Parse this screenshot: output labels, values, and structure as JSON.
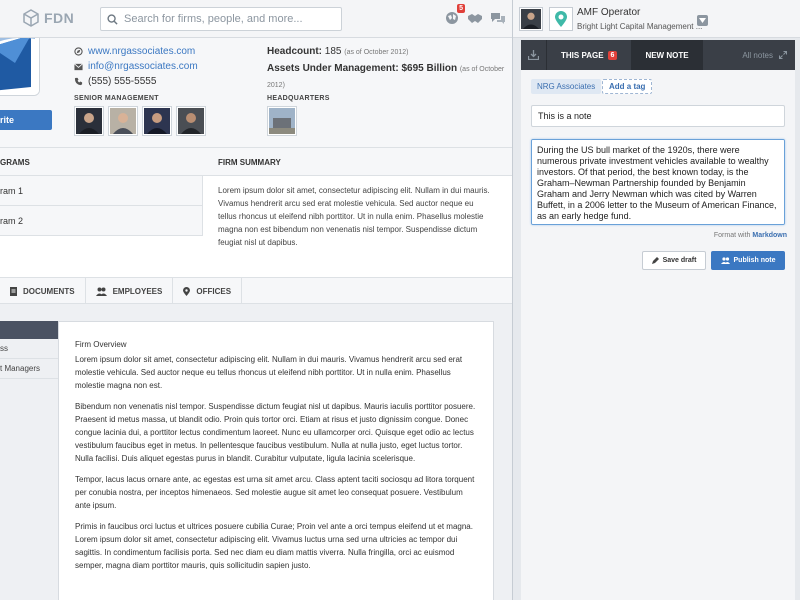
{
  "app": {
    "logo_text": "FDN"
  },
  "search": {
    "placeholder": "Search for firms, people, and more..."
  },
  "notifications": {
    "count": "5"
  },
  "profile": {
    "website": "www.nrgassociates.com",
    "email": "info@nrgassociates.com",
    "phone": "(555) 555-5555",
    "headcount_label": "Headcount:",
    "headcount_value": "185",
    "headcount_note": "(as of October 2012)",
    "aum_label": "Assets Under Management:",
    "aum_value": "$695 Billion",
    "aum_note": "(as of October 2012)",
    "favorite_label": "rite",
    "senior_management_label": "Senior Management",
    "headquarters_label": "Headquarters"
  },
  "programs": {
    "header": "grams",
    "items": [
      "ram 1",
      "ram 2"
    ]
  },
  "firm_summary": {
    "header": "Firm Summary",
    "text": "Lorem ipsum dolor sit amet, consectetur adipiscing elit. Nullam in dui mauris. Vivamus hendrerit arcu sed erat molestie vehicula. Sed auctor neque eu tellus rhoncus ut eleifend nibh porttitor. Ut in nulla enim. Phasellus molestie magna non est bibendum non venenatis nisl tempor. Suspendisse dictum feugiat nisl ut dapibus."
  },
  "tabs": [
    {
      "label": "Documents",
      "icon": "document-icon"
    },
    {
      "label": "Employees",
      "icon": "people-icon"
    },
    {
      "label": "Offices",
      "icon": "map-pin-icon"
    }
  ],
  "side_nav": {
    "items": [
      "ss",
      "t Managers"
    ]
  },
  "overview": {
    "title": "Firm Overview",
    "paragraphs": [
      "Lorem ipsum dolor sit amet, consectetur adipiscing elit. Nullam in dui mauris. Vivamus hendrerit arcu sed erat molestie vehicula. Sed auctor neque eu tellus rhoncus ut eleifend nibh porttitor. Ut in nulla enim. Phasellus molestie magna non est.",
      "Bibendum non venenatis nisl tempor. Suspendisse dictum feugiat nisl ut dapibus. Mauris iaculis porttitor posuere. Praesent id metus massa, ut blandit odio. Proin quis tortor orci. Etiam at risus et justo dignissim congue. Donec congue lacinia dui, a porttitor lectus condimentum laoreet. Nunc eu ullamcorper orci. Quisque eget odio ac lectus vestibulum faucibus eget in metus. In pellentesque faucibus vestibulum. Nulla at nulla justo, eget luctus tortor. Nulla facilisi. Duis aliquet egestas purus in blandit. Curabitur vulputate, ligula lacinia scelerisque.",
      "Tempor, lacus lacus ornare ante, ac egestas est urna sit amet arcu. Class aptent taciti sociosqu ad litora torquent per conubia nostra, per inceptos himenaeos. Sed molestie augue sit amet leo consequat posuere. Vestibulum ante ipsum.",
      "Primis in faucibus orci luctus et ultrices posuere cubilia Curae; Proin vel ante a orci tempus eleifend ut et magna. Lorem ipsum dolor sit amet, consectetur adipiscing elit. Vivamus luctus urna sed urna ultricies ac tempor dui sagittis. In condimentum facilisis porta. Sed nec diam eu diam mattis viverra. Nulla fringilla, orci ac euismod semper, magna diam porttitor mauris, quis sollicitudin sapien justo."
    ]
  },
  "user": {
    "name": "AMF Operator",
    "firm": "Bright Light Capital Management ..."
  },
  "notes_panel": {
    "tab_this_page": "This Page",
    "this_page_count": "6",
    "tab_new_note": "New Note",
    "all_notes": "All notes",
    "tag": "NRG Associates",
    "add_tag": "Add a tag",
    "note_title": "This is a note",
    "note_body": "During the US bull market of the 1920s, there were numerous private investment vehicles available to wealthy investors. Of that period, the best known today, is the Graham–Newman Partnership founded by Benjamin Graham and Jerry Newman which was cited by Warren Buffett, in a 2006 letter to the Museum of American Finance, as an early hedge fund.",
    "format_with": "Format with",
    "markdown": "Markdown",
    "save_draft": "Save draft",
    "publish": "Publish note"
  },
  "colors": {
    "accent": "#3b78c2",
    "badge": "#e0403a",
    "dark_tab": "#3a3f47"
  }
}
